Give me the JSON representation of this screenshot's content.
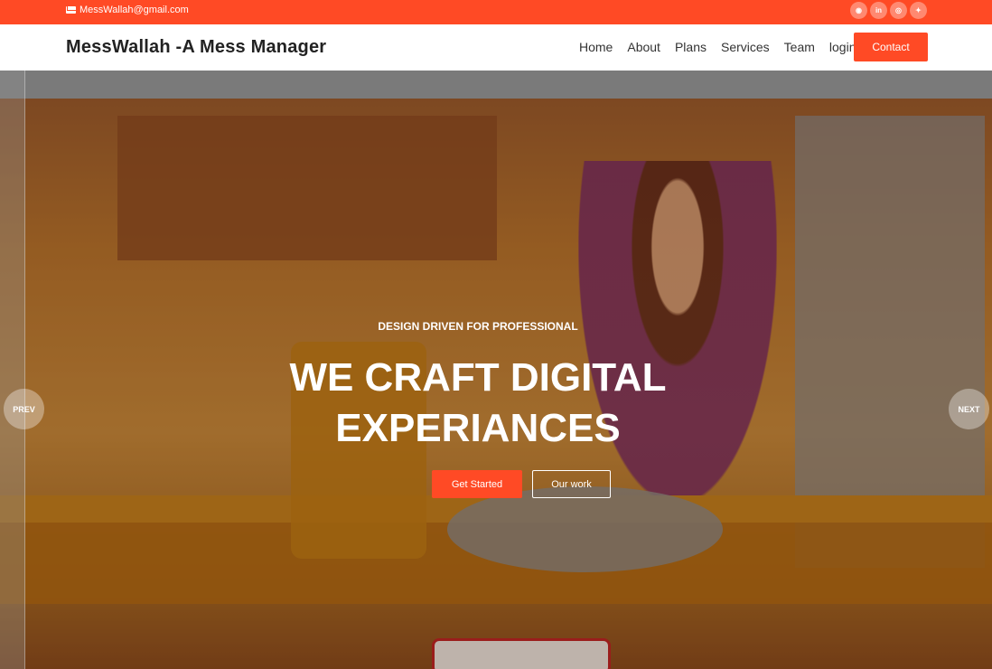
{
  "topbar": {
    "email": "MessWallah@gmail.com",
    "social": [
      {
        "icon": "github-icon",
        "glyph": "◉"
      },
      {
        "icon": "linkedin-icon",
        "glyph": "in"
      },
      {
        "icon": "instagram-icon",
        "glyph": "◎"
      },
      {
        "icon": "twitter-icon",
        "glyph": "✦"
      }
    ]
  },
  "header": {
    "logo": "MessWallah -A Mess Manager",
    "nav": [
      "Home",
      "About",
      "Plans",
      "Services",
      "Team",
      "login"
    ],
    "contact_label": "Contact"
  },
  "hero": {
    "subtitle": "DESIGN DRIVEN FOR PROFESSIONAL",
    "title_line1": "WE CRAFT DIGITAL",
    "title_line2": "EXPERIANCES",
    "primary_button": "Get Started",
    "secondary_button": "Our work",
    "prev_label": "PREV",
    "next_label": "NEXT"
  },
  "colors": {
    "accent": "#ff4a25"
  }
}
